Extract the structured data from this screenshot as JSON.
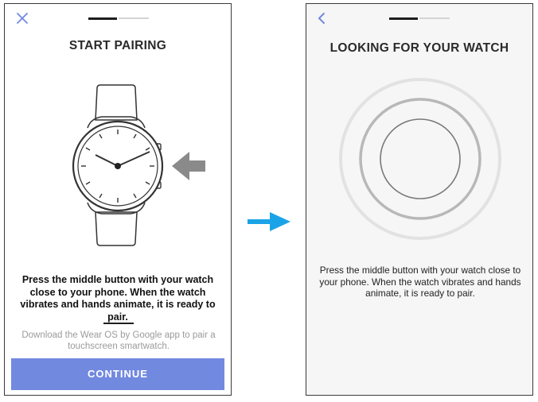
{
  "left_screen": {
    "close_icon": "close-icon",
    "progress": {
      "steps": 2,
      "current": 1
    },
    "title": "START PAIRING",
    "illustration": "watch-with-arrow",
    "instruction": "Press the middle button with your watch close to your phone. When the watch vibrates and hands animate, it is ready to pair.",
    "secondary": "Download the Wear OS by Google app to pair a touchscreen smartwatch.",
    "continue_label": "CONTINUE",
    "colors": {
      "button": "#7289e0",
      "close_icon": "#7289e0"
    }
  },
  "right_screen": {
    "back_icon": "chevron-left-icon",
    "progress": {
      "steps": 2,
      "current": 1
    },
    "title": "LOOKING FOR YOUR WATCH",
    "illustration": "searching-rings",
    "instruction": "Press the middle button with your watch close to your phone. When the watch vibrates and hands animate, it is ready to pair."
  },
  "flow_arrow": {
    "icon": "arrow-right-icon",
    "color": "#1ba3e8"
  }
}
